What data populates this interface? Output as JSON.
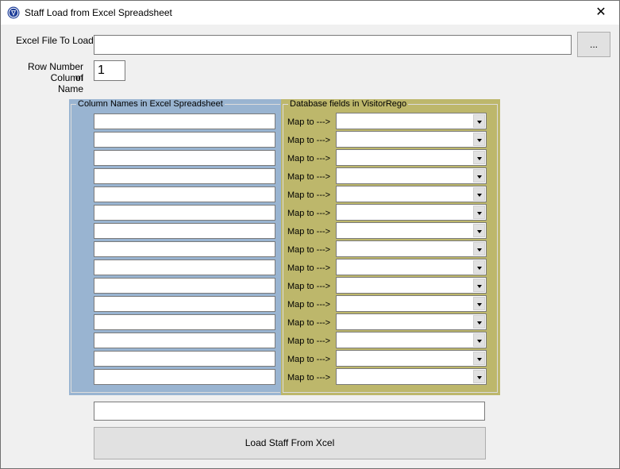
{
  "window": {
    "title": "Staff Load from Excel Spreadsheet",
    "close_glyph": "✕"
  },
  "form": {
    "excel_file_label": "Excel File To Load",
    "excel_file_value": "",
    "browse_label": "...",
    "row_number_label_line1": "Row Number of",
    "row_number_label_line2": "Column Name",
    "row_number_value": "1"
  },
  "columns_group": {
    "title": "Column Names in Excel Spreadsheet",
    "values": [
      "",
      "",
      "",
      "",
      "",
      "",
      "",
      "",
      "",
      "",
      "",
      "",
      "",
      "",
      ""
    ]
  },
  "db_group": {
    "title": "Database fields in VisitorRego",
    "map_label": "Map to --->",
    "selected": [
      "",
      "",
      "",
      "",
      "",
      "",
      "",
      "",
      "",
      "",
      "",
      "",
      "",
      "",
      ""
    ]
  },
  "status": {
    "value": ""
  },
  "load_button": {
    "label": "Load Staff From Xcel"
  },
  "colors": {
    "left_panel": "#99b4d1",
    "right_panel": "#bdb76b",
    "window_bg": "#f0f0f0"
  }
}
